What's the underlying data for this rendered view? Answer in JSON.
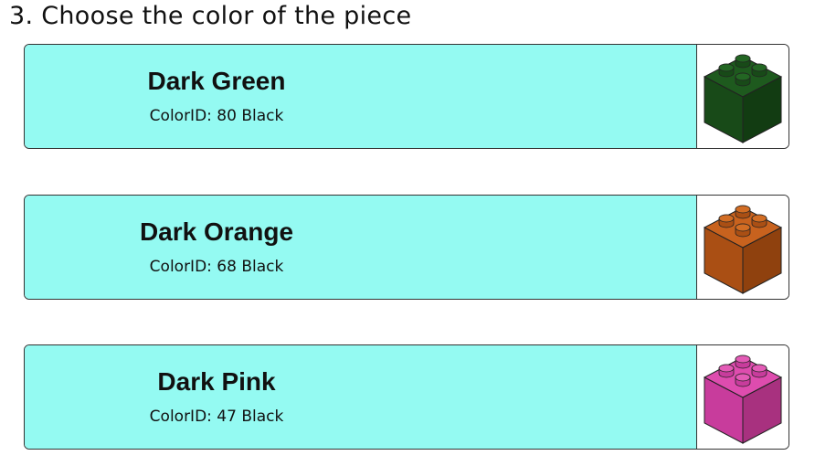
{
  "heading": "3. Choose the color of the piece",
  "options": [
    {
      "name": "Dark Green",
      "colorid": "ColorID: 80 Black",
      "bg": "#94faf2",
      "brick": {
        "top": "#1e5a1e",
        "left": "#184a18",
        "right": "#123c12",
        "stud": "#236623"
      }
    },
    {
      "name": "Dark Orange",
      "colorid": "ColorID: 68 Black",
      "bg": "#94faf2",
      "brick": {
        "top": "#c8621e",
        "left": "#aa4f14",
        "right": "#8f410e",
        "stud": "#d26d24"
      }
    },
    {
      "name": "Dark Pink",
      "colorid": "ColorID: 47 Black",
      "bg": "#94faf2",
      "brick": {
        "top": "#de4cae",
        "left": "#c83c9c",
        "right": "#a8317f",
        "stud": "#e35bb6"
      }
    }
  ]
}
